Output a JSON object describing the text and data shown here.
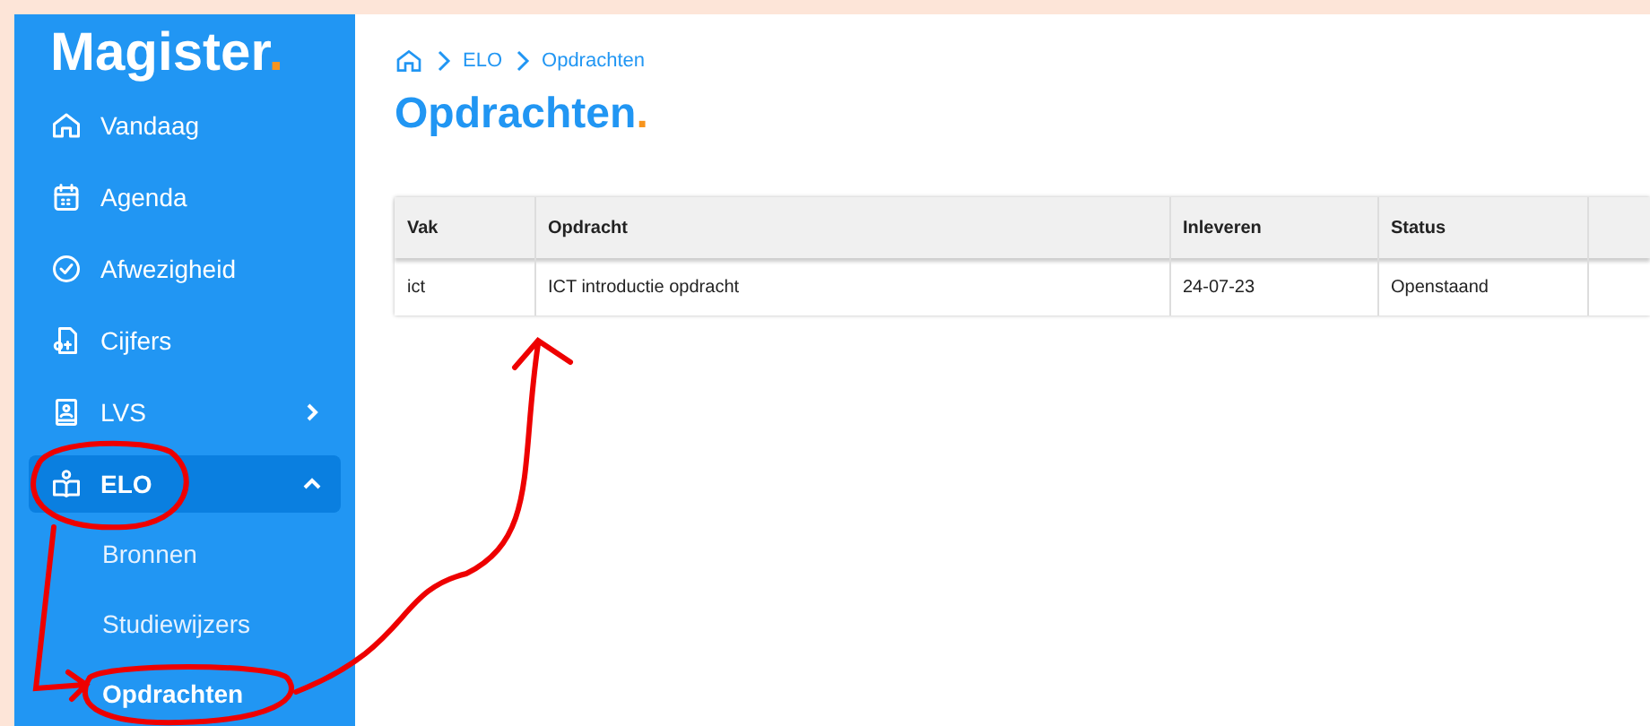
{
  "logo": {
    "text": "Magister",
    "dot": "."
  },
  "sidebar": {
    "items": [
      {
        "kind": "home",
        "label": "Vandaag",
        "selected": false
      },
      {
        "kind": "calendar",
        "label": "Agenda",
        "selected": false
      },
      {
        "kind": "check",
        "label": "Afwezigheid",
        "selected": false
      },
      {
        "kind": "grades",
        "label": "Cijfers",
        "selected": false
      },
      {
        "kind": "profile",
        "label": "LVS",
        "expanded": false,
        "selected": false
      },
      {
        "kind": "elo",
        "label": "ELO",
        "expanded": true,
        "selected": true,
        "children": [
          {
            "label": "Bronnen",
            "selected": false
          },
          {
            "label": "Studiewijzers",
            "selected": false
          },
          {
            "label": "Opdrachten",
            "selected": true
          }
        ]
      }
    ]
  },
  "breadcrumb": [
    "ELO",
    "Opdrachten"
  ],
  "page_title": {
    "text": "Opdrachten",
    "dot": "."
  },
  "table": {
    "columns": [
      "Vak",
      "Opdracht",
      "Inleveren",
      "Status"
    ],
    "rows": [
      [
        "ict",
        "ICT introductie opdracht",
        "24-07-23",
        "Openstaand"
      ]
    ]
  }
}
